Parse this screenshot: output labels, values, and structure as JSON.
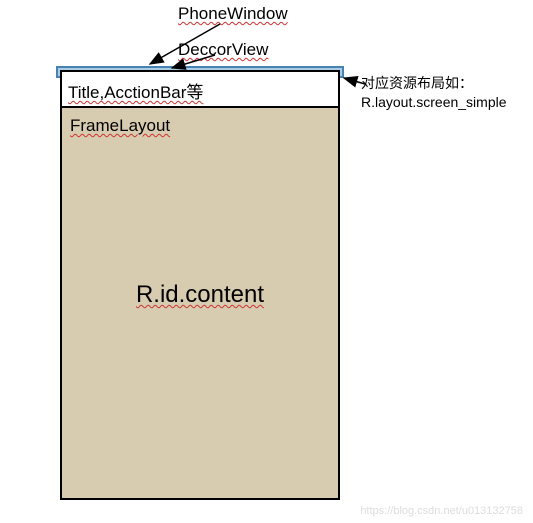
{
  "labels": {
    "phonewindow": "PhoneWindow",
    "deccorview": "DeccorView",
    "title_bar": "Title,AcctionBar等",
    "frame_layout": "FrameLayout",
    "content_id": "R.id.content"
  },
  "annotation": {
    "line1": "对应资源布局如：",
    "line2": "R.layout.screen_simple"
  },
  "watermark": "https://blog.csdn.net/u013132758"
}
